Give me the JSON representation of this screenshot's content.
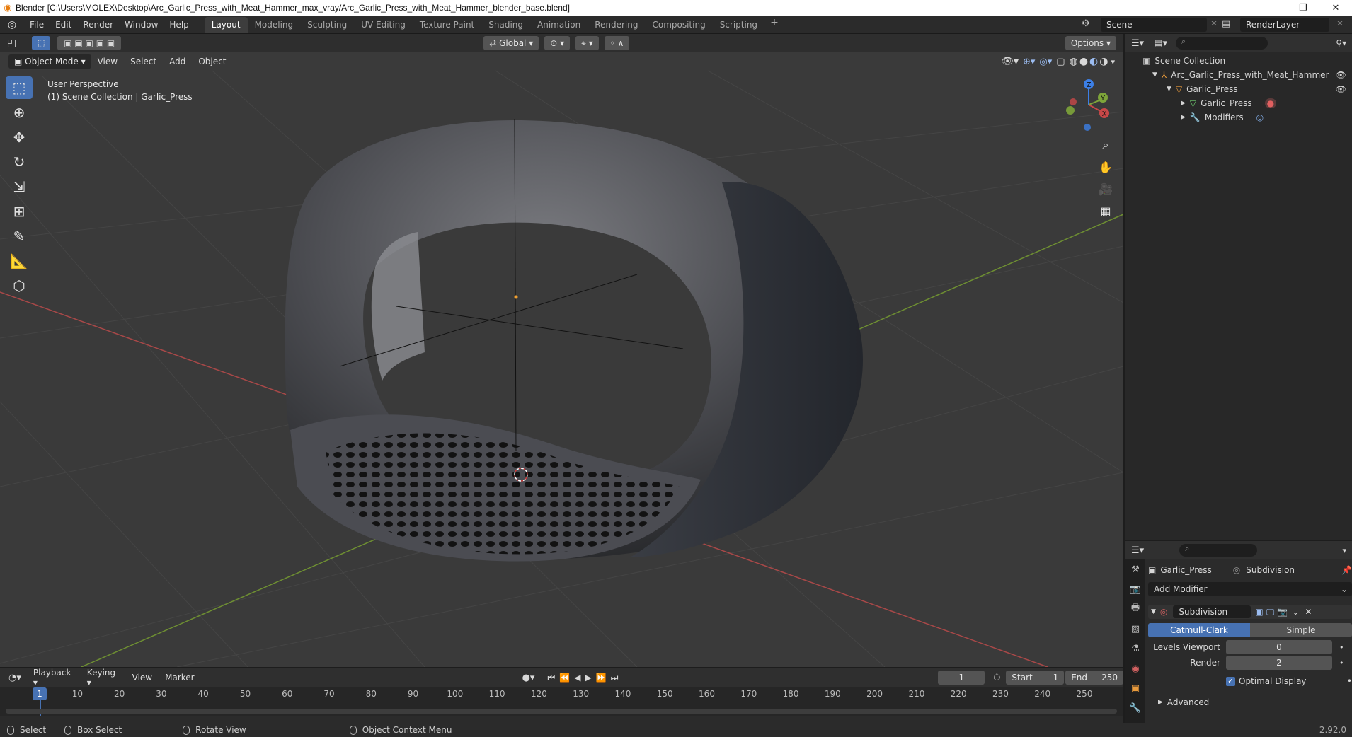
{
  "title_bar": {
    "text": "Blender [C:\\Users\\MOLEX\\Desktop\\Arc_Garlic_Press_with_Meat_Hammer_max_vray/Arc_Garlic_Press_with_Meat_Hammer_blender_base.blend]",
    "minimize": "—",
    "maximize": "❐",
    "close": "✕"
  },
  "menu": [
    "File",
    "Edit",
    "Render",
    "Window",
    "Help"
  ],
  "workspaces": [
    "Layout",
    "Modeling",
    "Sculpting",
    "UV Editing",
    "Texture Paint",
    "Shading",
    "Animation",
    "Rendering",
    "Compositing",
    "Scripting"
  ],
  "workspace_add": "+",
  "scene_name": "Scene",
  "render_layer": "RenderLayer",
  "viewport": {
    "orientation": "Global",
    "options_label": "Options",
    "mode": "Object Mode",
    "menus": [
      "View",
      "Select",
      "Add",
      "Object"
    ],
    "info_line1": "User Perspective",
    "info_line2": "(1) Scene Collection | Garlic_Press",
    "gizmo": {
      "z": "Z",
      "y": "Y",
      "x": "X"
    }
  },
  "outliner": {
    "root": "Scene Collection",
    "items": [
      {
        "label": "Arc_Garlic_Press_with_Meat_Hammer",
        "depth": 1
      },
      {
        "label": "Garlic_Press",
        "depth": 2
      },
      {
        "label": "Garlic_Press",
        "depth": 3
      },
      {
        "label": "Modifiers",
        "depth": 3
      }
    ]
  },
  "properties": {
    "object_name": "Garlic_Press",
    "modifier_context": "Subdivision",
    "add_modifier": "Add Modifier",
    "modifier_name": "Subdivision",
    "mode_catmull": "Catmull-Clark",
    "mode_simple": "Simple",
    "levels_viewport_label": "Levels Viewport",
    "levels_viewport_value": "0",
    "render_label": "Render",
    "render_value": "2",
    "optimal_display": "Optimal Display",
    "advanced": "Advanced"
  },
  "timeline": {
    "menus": [
      "Playback",
      "Keying",
      "View",
      "Marker"
    ],
    "current_frame": "1",
    "start_label": "Start",
    "start_value": "1",
    "end_label": "End",
    "end_value": "250",
    "ticks": [
      "1",
      "10",
      "20",
      "30",
      "40",
      "50",
      "60",
      "70",
      "80",
      "90",
      "100",
      "110",
      "120",
      "130",
      "140",
      "150",
      "160",
      "170",
      "180",
      "190",
      "200",
      "210",
      "220",
      "230",
      "240",
      "250"
    ]
  },
  "statusbar": {
    "select": "Select",
    "box_select": "Box Select",
    "rotate_view": "Rotate View",
    "context_menu": "Object Context Menu",
    "version": "2.92.0"
  },
  "colors": {
    "accent": "#4772b3",
    "x_axis": "#c84848",
    "y_axis": "#7ea53a",
    "z_axis": "#3c7fe6"
  }
}
